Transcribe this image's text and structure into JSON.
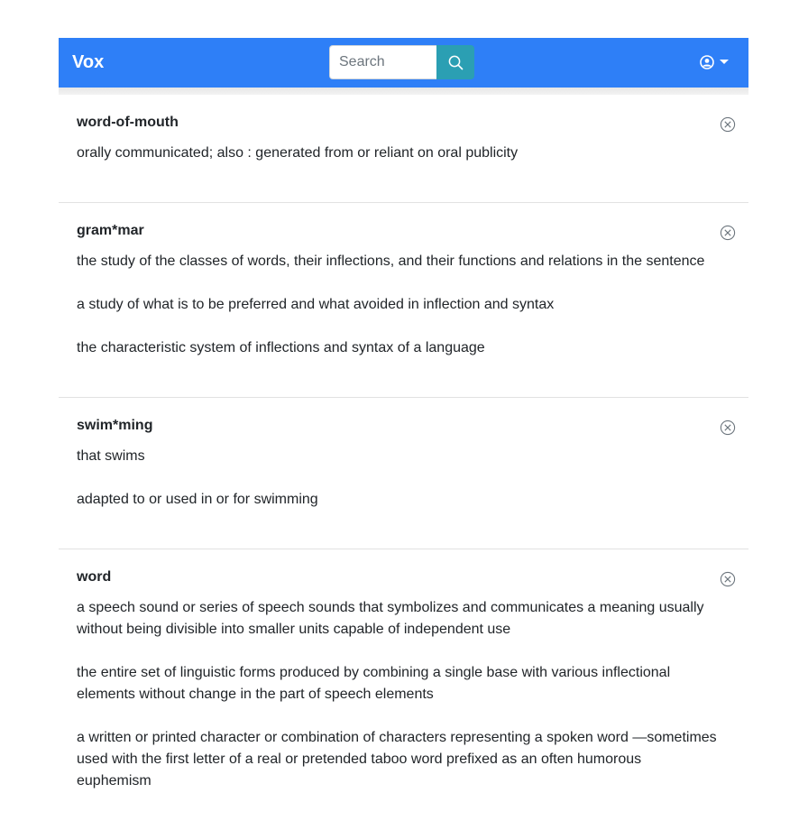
{
  "app": {
    "brand": "Vox",
    "search": {
      "placeholder": "Search",
      "value": ""
    },
    "user_menu": {
      "icon": "user-circle-icon"
    }
  },
  "entries": [
    {
      "term": "word-of-mouth",
      "definitions": [
        "orally communicated; also : generated from or reliant on oral publicity"
      ]
    },
    {
      "term": "gram*mar",
      "definitions": [
        "the study of the classes of words, their inflections, and their functions and relations in the sentence",
        "a study of what is to be preferred and what avoided in inflection and syntax",
        "the characteristic system of inflections and syntax of a language"
      ]
    },
    {
      "term": "swim*ming",
      "definitions": [
        "that swims",
        "adapted to or used in or for swimming"
      ]
    },
    {
      "term": "word",
      "definitions": [
        "a speech sound or series of speech sounds that symbolizes and communicates a meaning usually without being divisible into smaller units capable of independent use",
        "the entire set of linguistic forms produced by combining a single base with various inflectional elements without change in the part of speech elements",
        "a written or printed character or combination of characters representing a spoken word —sometimes used with the first letter of a real or pretended taboo word prefixed as an often humorous euphemism"
      ]
    }
  ],
  "colors": {
    "navbar": "#2e7ff7",
    "search_button": "#2b9fb3"
  }
}
